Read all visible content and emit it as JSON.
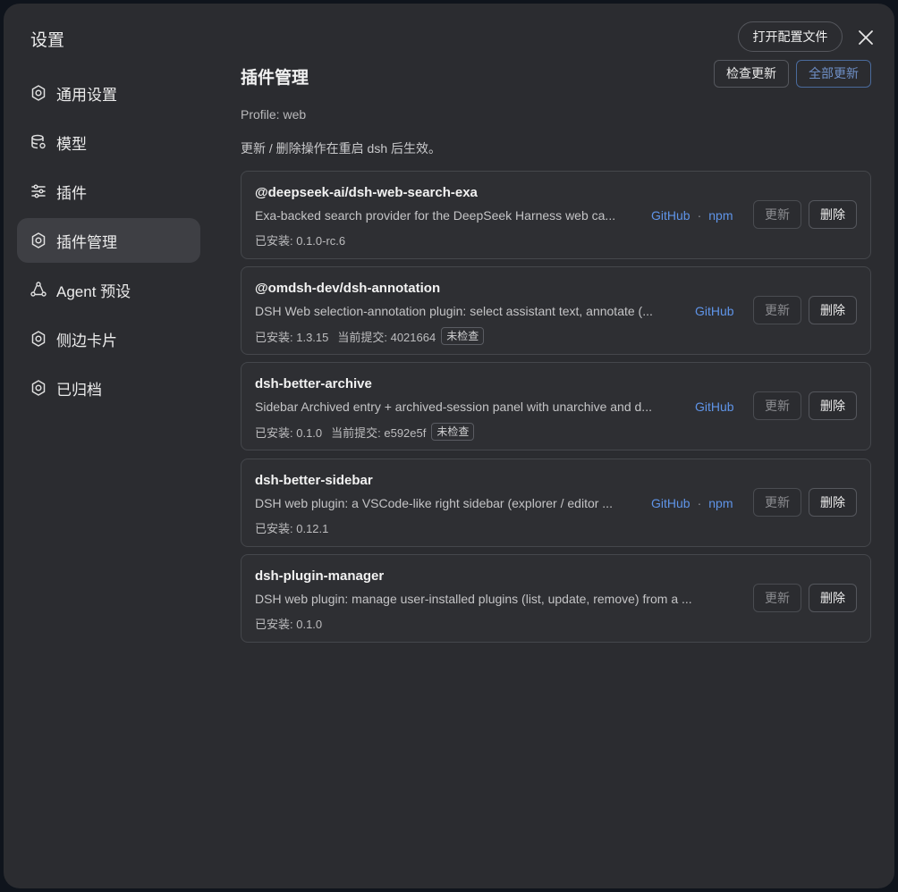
{
  "dialog": {
    "title": "设置",
    "open_config_label": "打开配置文件",
    "close_icon": "close-icon"
  },
  "sidebar": {
    "items": [
      {
        "label": "通用设置",
        "icon": "gear-icon",
        "active": false
      },
      {
        "label": "模型",
        "icon": "database-icon",
        "active": false
      },
      {
        "label": "插件",
        "icon": "sliders-icon",
        "active": false
      },
      {
        "label": "插件管理",
        "icon": "gear-icon",
        "active": true
      },
      {
        "label": "Agent 预设",
        "icon": "agent-cycle-icon",
        "active": false
      },
      {
        "label": "侧边卡片",
        "icon": "gear-icon",
        "active": false
      },
      {
        "label": "已归档",
        "icon": "gear-icon",
        "active": false
      }
    ]
  },
  "main": {
    "title": "插件管理",
    "check_update_label": "检查更新",
    "update_all_label": "全部更新",
    "profile": "Profile: web",
    "notice": "更新 / 删除操作在重启 dsh 后生效。",
    "plugins": [
      {
        "name": "@deepseek-ai/dsh-web-search-exa",
        "description": "Exa-backed search provider for the DeepSeek Harness web ca...",
        "installed": "已安装: 0.1.0-rc.6",
        "commit": "",
        "tag": "",
        "links": [
          "GitHub",
          "npm"
        ],
        "update_label": "更新",
        "delete_label": "删除"
      },
      {
        "name": "@omdsh-dev/dsh-annotation",
        "description": "DSH Web selection-annotation plugin: select assistant text, annotate (...",
        "installed": "已安装: 1.3.15",
        "commit": "当前提交: 4021664",
        "tag": "未检查",
        "links": [
          "GitHub"
        ],
        "update_label": "更新",
        "delete_label": "删除"
      },
      {
        "name": "dsh-better-archive",
        "description": "Sidebar Archived entry + archived-session panel with unarchive and d...",
        "installed": "已安装: 0.1.0",
        "commit": "当前提交: e592e5f",
        "tag": "未检查",
        "links": [
          "GitHub"
        ],
        "update_label": "更新",
        "delete_label": "删除"
      },
      {
        "name": "dsh-better-sidebar",
        "description": "DSH web plugin: a VSCode-like right sidebar (explorer / editor ...",
        "installed": "已安装: 0.12.1",
        "commit": "",
        "tag": "",
        "links": [
          "GitHub",
          "npm"
        ],
        "update_label": "更新",
        "delete_label": "删除"
      },
      {
        "name": "dsh-plugin-manager",
        "description": "DSH web plugin: manage user-installed plugins (list, update, remove) from a ...",
        "installed": "已安装: 0.1.0",
        "commit": "",
        "tag": "",
        "links": [],
        "update_label": "更新",
        "delete_label": "删除"
      }
    ]
  },
  "colors": {
    "background": "#2b2c30",
    "link": "#5f94e8",
    "active_item": "#3e3f44"
  }
}
